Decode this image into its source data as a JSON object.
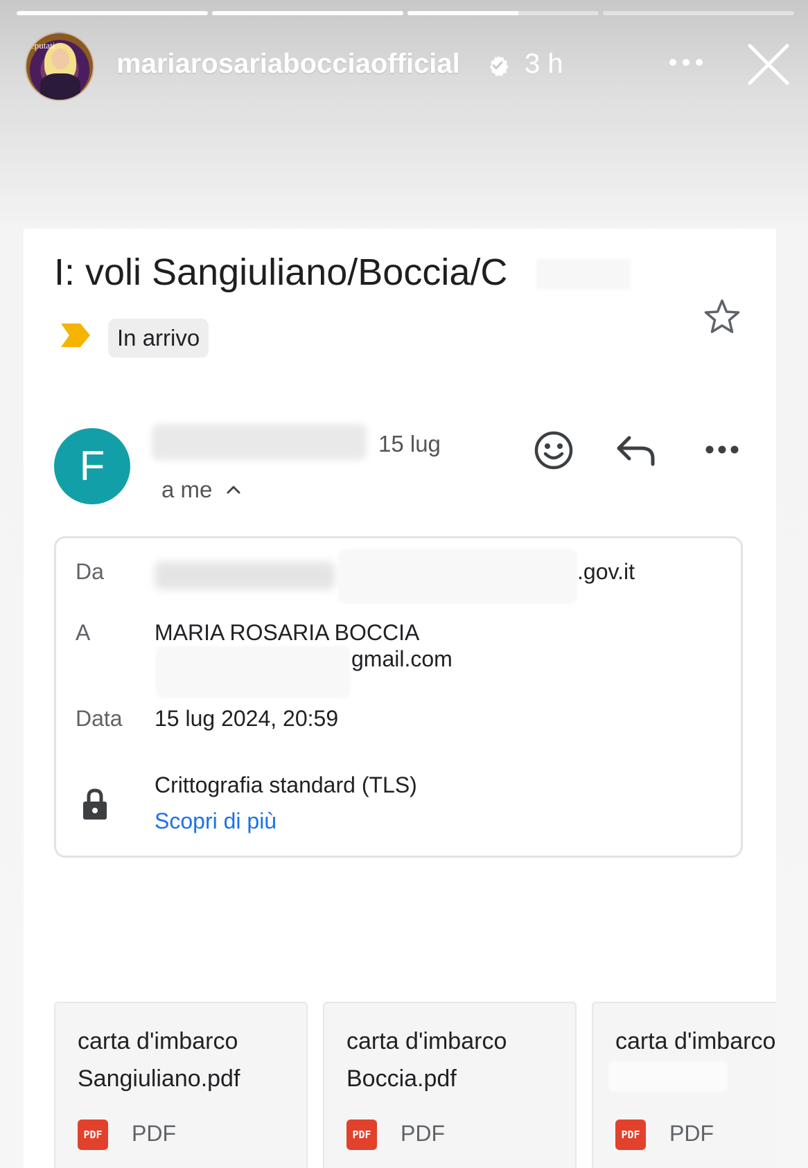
{
  "story": {
    "username": "mariarosariabocciaofficial",
    "time_ago": "3 h",
    "progress": [
      1,
      1,
      0.58,
      0
    ],
    "avatar_text": "eputati"
  },
  "email": {
    "subject": "I: voli Sangiuliano/Boccia/C",
    "label": "In arrivo",
    "sender_initial": "F",
    "date_short": "15 lug",
    "recipient_short": "a me",
    "details": {
      "from_label": "Da",
      "from_value_suffix": ".gov.it",
      "to_label": "A",
      "to_name": "MARIA ROSARIA BOCCIA",
      "to_email_suffix": "gmail.com",
      "date_label": "Data",
      "date_value": "15 lug 2024, 20:59",
      "encryption": "Crittografia standard (TLS)",
      "learn_more": "Scopri di più"
    },
    "attachments": [
      {
        "line1": "carta d'imbarco",
        "line2": "Sangiuliano.pdf",
        "badge": "PDF",
        "type": "PDF"
      },
      {
        "line1": "carta d'imbarco",
        "line2": "Boccia.pdf",
        "badge": "PDF",
        "type": "PDF"
      },
      {
        "line1": "carta d'imbarco",
        "line2": "",
        "badge": "PDF",
        "type": "PDF"
      }
    ]
  },
  "colors": {
    "sender_avatar": "#139fa7",
    "label_marker": "#f4b400",
    "link": "#1a73e8",
    "pdf_badge": "#e2412c"
  },
  "icons": [
    "verified-badge-icon",
    "more-dots-icon",
    "close-icon",
    "star-icon",
    "label-arrow-icon",
    "chevron-up-icon",
    "emoji-icon",
    "reply-icon",
    "more-options-icon",
    "lock-icon",
    "pdf-icon"
  ]
}
